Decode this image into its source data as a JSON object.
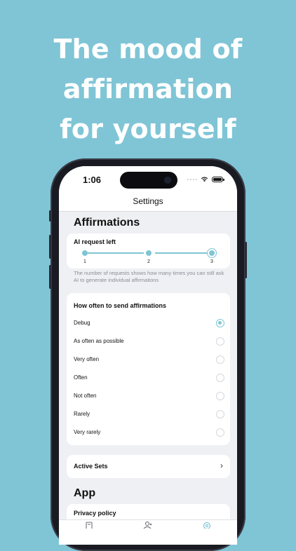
{
  "headline": [
    "The mood of",
    "affirmation",
    "for yourself"
  ],
  "status_bar": {
    "time": "1:06"
  },
  "nav": {
    "title": "Settings"
  },
  "affirmations": {
    "section_title": "Affirmations",
    "ai_request": {
      "title": "AI request left",
      "ticks": [
        "1",
        "2",
        "3"
      ],
      "selected_value": 3,
      "hint": "The number of requests shows how many times you can still ask AI to generate individual affirmations"
    },
    "frequency": {
      "title": "How often to send affirmations",
      "options": [
        "Debug",
        "As often as possible",
        "Very often",
        "Often",
        "Not often",
        "Rarely",
        "Very rarely"
      ],
      "selected": "Debug"
    },
    "active_sets": {
      "label": "Active Sets",
      "chevron": "›"
    }
  },
  "app": {
    "section_title": "App",
    "privacy_label": "Privacy policy"
  },
  "icons": [
    "wifi-icon",
    "battery-icon",
    "chevron-right-icon",
    "journal-tab-icon",
    "person-tab-icon",
    "settings-tab-icon"
  ],
  "colors": {
    "background": "#7fc5d6",
    "accent": "#7fc5d6",
    "screen_bg": "#eef0f4"
  }
}
